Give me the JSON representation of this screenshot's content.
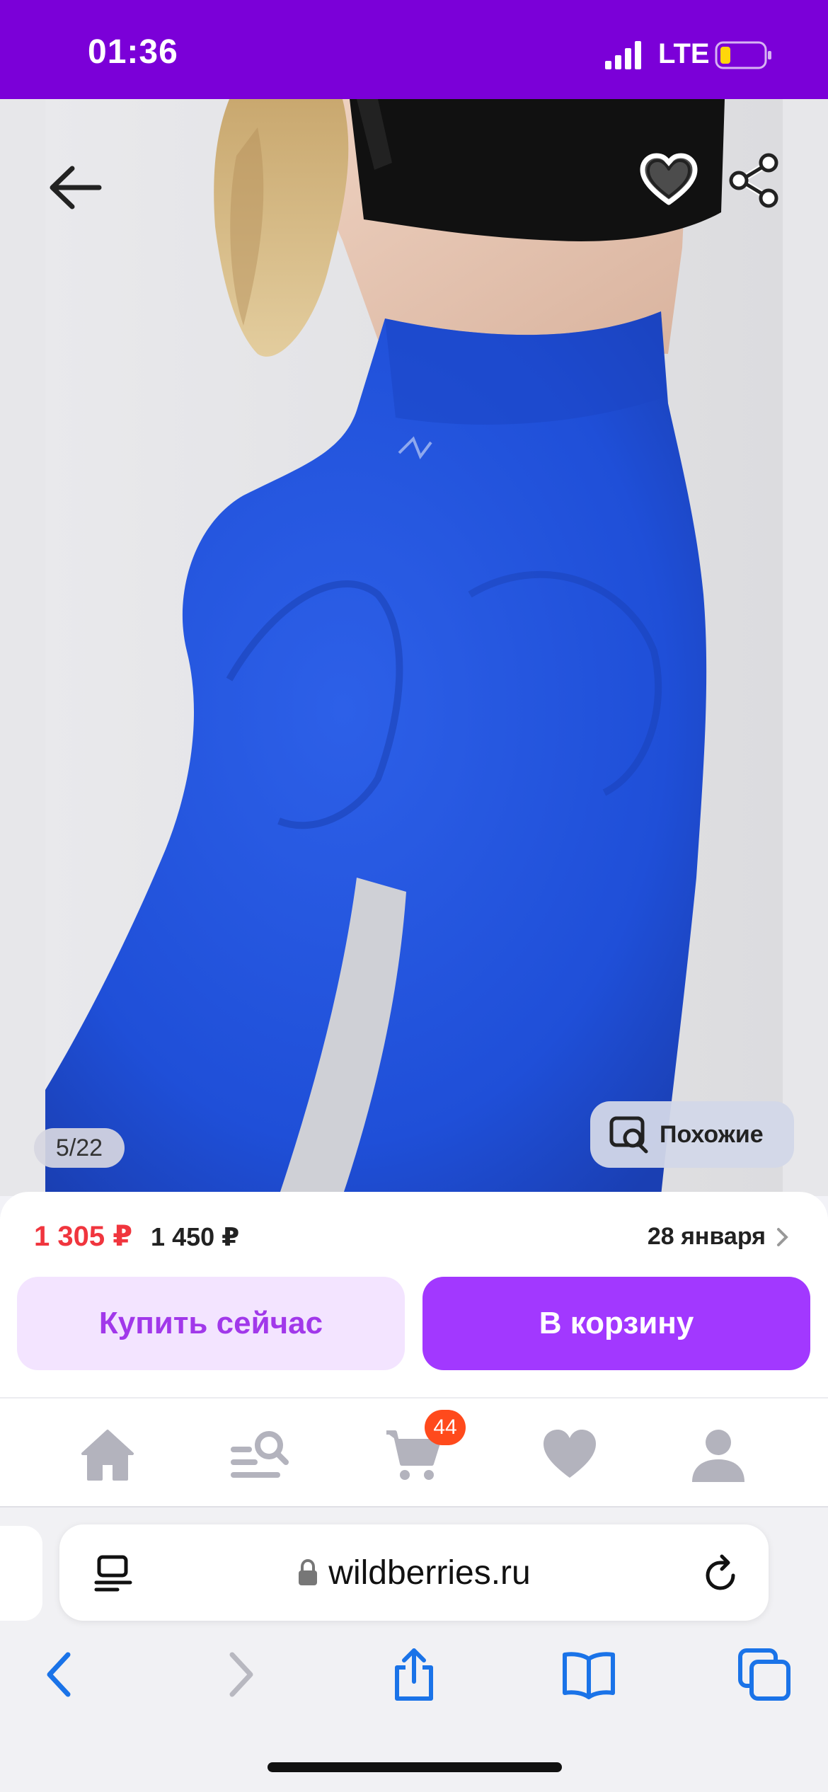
{
  "status_bar": {
    "time": "01:36",
    "network": "LTE"
  },
  "gallery": {
    "image_counter": "5/22",
    "similar_label": "Похожие"
  },
  "product": {
    "price_current": "1 305 ₽",
    "price_old": "1 450 ₽",
    "delivery_date": "28 января",
    "buy_now_label": "Купить сейчас",
    "add_to_cart_label": "В корзину"
  },
  "site_nav": {
    "items": [
      {
        "icon": "home-icon"
      },
      {
        "icon": "catalog-search-icon"
      },
      {
        "icon": "cart-icon"
      },
      {
        "icon": "heart-icon"
      },
      {
        "icon": "profile-icon"
      }
    ],
    "cart_count": "44"
  },
  "browser": {
    "url": "wildberries.ru"
  },
  "colors": {
    "brand_purple": "#7b00d8",
    "button_purple": "#a238ff",
    "button_light": "#f3e4ff",
    "price_red": "#f0353e",
    "badge_orange": "#ff4a1c",
    "legging_blue": "#1f4fd8"
  }
}
